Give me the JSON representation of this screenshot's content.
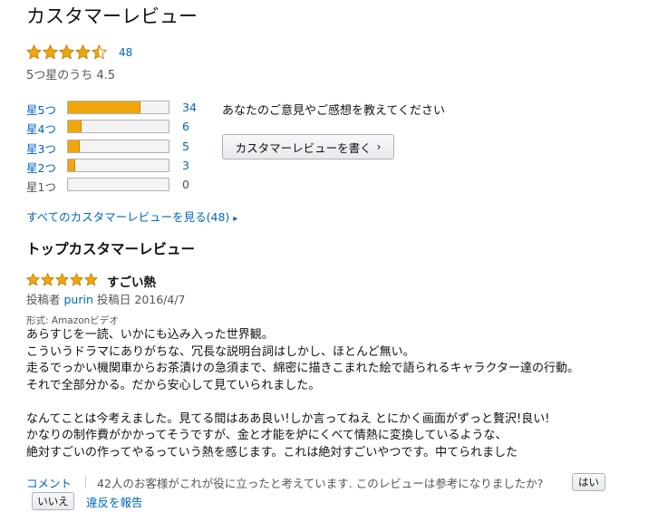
{
  "heading": "カスタマーレビュー",
  "summary": {
    "stars_value": 4.5,
    "rating_count": "48",
    "out_of_text": "5つ星のうち 4.5"
  },
  "histogram": [
    {
      "label": "星5つ",
      "count": "34",
      "fraction": 0.708,
      "linked": true
    },
    {
      "label": "星4つ",
      "count": "6",
      "fraction": 0.125,
      "linked": true
    },
    {
      "label": "星3つ",
      "count": "5",
      "fraction": 0.104,
      "linked": true
    },
    {
      "label": "星2つ",
      "count": "3",
      "fraction": 0.0625,
      "linked": true
    },
    {
      "label": "星1つ",
      "count": "0",
      "fraction": 0,
      "linked": false
    }
  ],
  "feedback": {
    "prompt": "あなたのご意見やご感想を教えてください",
    "write_button": "カスタマーレビューを書く"
  },
  "all_reviews_link": "すべてのカスタマーレビューを見る(48)",
  "top_reviews_heading": "トップカスタマーレビュー",
  "review": {
    "stars_value": 5,
    "title": "すごい熱",
    "posted_by_label": "投稿者",
    "author": "purin",
    "date": "投稿日 2016/4/7",
    "format": "形式: Amazonビデオ",
    "body_lines": [
      "あらすじを一読、いかにも込み入った世界観。",
      "こういうドラマにありがちな、冗長な説明台詞はしかし、ほとんど無い。",
      "走るでっかい機関車からお茶漬けの急須まで、綿密に描きこまれた絵で語られるキャラクター達の行動。",
      "それで全部分かる。だから安心して見ていられました。",
      "",
      "なんてことは今考えました。見てる間はああ良い!しか言ってねえ とにかく画面がずっと贅沢!良い!",
      "かなりの制作費がかかってそうですが、金と才能を炉にくべて情熱に変換しているような、",
      "絶対すごいの作ってやるっていう熱を感じます。これは絶対すごいやつです。中てられました"
    ],
    "comment_link": "コメント",
    "helpful_text": "42人のお客様がこれが役に立ったと考えています. このレビューは参考になりましたか?",
    "yes_button": "はい",
    "no_button": "いいえ",
    "report_link": "違反を報告"
  },
  "colors": {
    "star": "#f0a70e",
    "link": "#0066c0",
    "bar_fill": "#f0a70e"
  }
}
